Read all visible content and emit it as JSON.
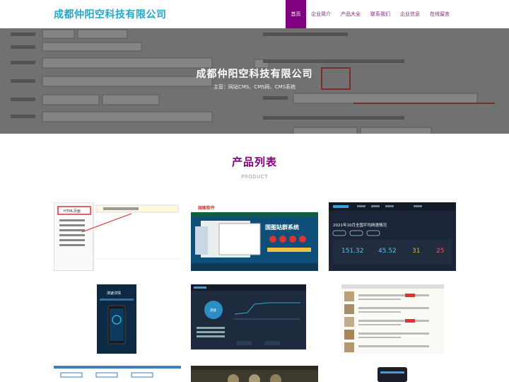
{
  "site": {
    "logo": "成都仲阳空科技有限公司"
  },
  "nav": [
    {
      "label": "首页",
      "active": true
    },
    {
      "label": "企业简介"
    },
    {
      "label": "产品大全"
    },
    {
      "label": "联系我们"
    },
    {
      "label": "企业信息"
    },
    {
      "label": "在线留言"
    }
  ],
  "banner": {
    "title": "成都仲阳空科技有限公司",
    "subtitle": "主营：网站CMS、CMS网、CMS系统"
  },
  "products": {
    "title": "产品列表",
    "subtitle": "PRODUCT",
    "items": [
      {
        "name": "product-1",
        "text": "HTML页面"
      },
      {
        "name": "product-2",
        "text": "国图软件",
        "text2": "国图站群系统"
      },
      {
        "name": "product-3",
        "text": "2021年10月全国平均网速情况",
        "v1": "151.32",
        "v2": "45.52",
        "v3": "31",
        "v4": "25"
      },
      {
        "name": "product-4",
        "text": "测速详情"
      },
      {
        "name": "product-5",
        "text": "测速"
      },
      {
        "name": "product-6",
        "text": ""
      },
      {
        "name": "product-7",
        "text": ""
      },
      {
        "name": "product-8",
        "text": ""
      },
      {
        "name": "product-9",
        "text": ""
      }
    ]
  }
}
